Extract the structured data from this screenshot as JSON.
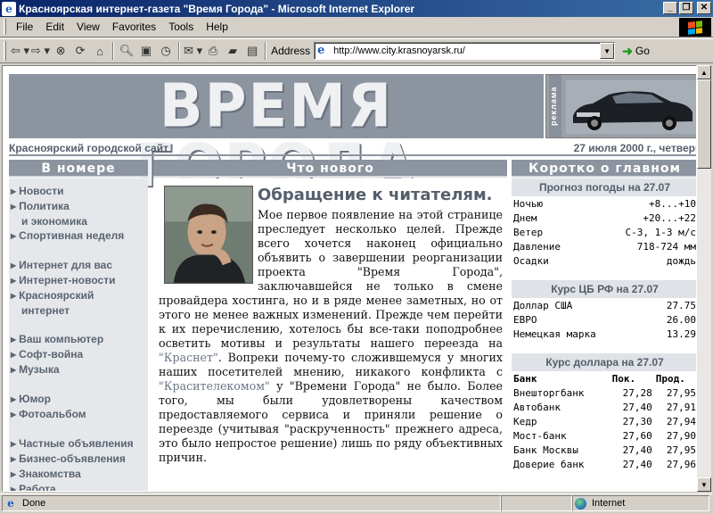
{
  "window": {
    "title": "Красноярская интернет-газета \"Время Города\" - Microsoft Internet Explorer",
    "controls": [
      "_",
      "❐",
      "✕"
    ]
  },
  "menu": {
    "items": [
      "File",
      "Edit",
      "View",
      "Favorites",
      "Tools",
      "Help"
    ]
  },
  "toolbar": {
    "address_label": "Address",
    "address_value": "http://www.city.krasnoyarsk.ru/",
    "go_label": "Go"
  },
  "masthead": {
    "logo": "ВРЕМЯ ГОРОДА",
    "ad_label": "реклама",
    "left_caption": "Красноярский городской сайт",
    "right_caption": "27 июля 2000 г., четверг"
  },
  "left_column": {
    "heading": "В номере",
    "items": [
      {
        "label": "Новости"
      },
      {
        "label": "Политика"
      },
      {
        "label": "и экономика",
        "indent": true
      },
      {
        "label": "Спортивная неделя"
      },
      {
        "gap": true
      },
      {
        "label": "Интернет для вас"
      },
      {
        "label": "Интернет-новости"
      },
      {
        "label": "Красноярский"
      },
      {
        "label": "интернет",
        "indent": true
      },
      {
        "gap": true
      },
      {
        "label": "Ваш компьютер"
      },
      {
        "label": "Софт-война"
      },
      {
        "label": "Музыка"
      },
      {
        "gap": true
      },
      {
        "label": "Юмор"
      },
      {
        "label": "Фотоальбом"
      },
      {
        "gap": true
      },
      {
        "label": "Частные объявления"
      },
      {
        "label": "Бизнес-объявления"
      },
      {
        "label": "Знакомства"
      },
      {
        "label": "Работа"
      }
    ]
  },
  "center_column": {
    "heading": "Что нового",
    "article_title": "Обращение к читателям.",
    "article_p1": "Мое первое появление на этой странице преследует несколько целей. Прежде всего хочется наконец официально объявить о завершении реорганизации проекта \"Время Города\", заключавшейся не только в смене провайдера хостинга, но и в ряде менее заметных, но от этого не менее важных изменений. Прежде чем перейти к их перечислению, хотелось бы все-таки поподробнее осветить мотивы и результаты нашего переезда на ",
    "link1": "\"Краснет\"",
    "article_p2": ". Вопреки почему-то сложившемуся у многих наших посетителей мнению, никакого конфликта с ",
    "link2": "\"Красителекомом\"",
    "article_p3": " у \"Времени Города\" не было. Более того, мы были удовлетворены качеством предоставляемого сервиса и приняли решение о переезде (учитывая \"раскрученность\" прежнего адреса, это было непростое решение) лишь по ряду объективных причин."
  },
  "right_column": {
    "heading": "Коротко о главном",
    "weather": {
      "title": "Прогноз погоды на 27.07",
      "rows": [
        [
          "Ночью",
          "+8...+10"
        ],
        [
          "Днем",
          "+20...+22"
        ],
        [
          "Ветер",
          "С-З, 1-3 м/с"
        ],
        [
          "Давление",
          "718-724 мм"
        ],
        [
          "Осадки",
          "дождь"
        ]
      ]
    },
    "cb_rates": {
      "title": "Курс ЦБ РФ на 27.07",
      "rows": [
        [
          "Доллар США",
          "27.75"
        ],
        [
          "ЕВРО",
          "26.00"
        ],
        [
          "Немецкая марка",
          "13.29"
        ]
      ]
    },
    "dollar_rates": {
      "title": "Курс доллара на 27.07",
      "headers": [
        "Банк",
        "Пок.",
        "Прод."
      ],
      "rows": [
        [
          "Внешторгбанк",
          "27,28",
          "27,95"
        ],
        [
          "Автобанк",
          "27,40",
          "27,91"
        ],
        [
          "Кедр",
          "27,30",
          "27,94"
        ],
        [
          "Мост-банк",
          "27,60",
          "27,90"
        ],
        [
          "Банк Москвы",
          "27,40",
          "27,95"
        ],
        [
          "Доверие банк",
          "27,40",
          "27,96"
        ]
      ]
    }
  },
  "status": {
    "left": "Done",
    "zone": "Internet"
  }
}
